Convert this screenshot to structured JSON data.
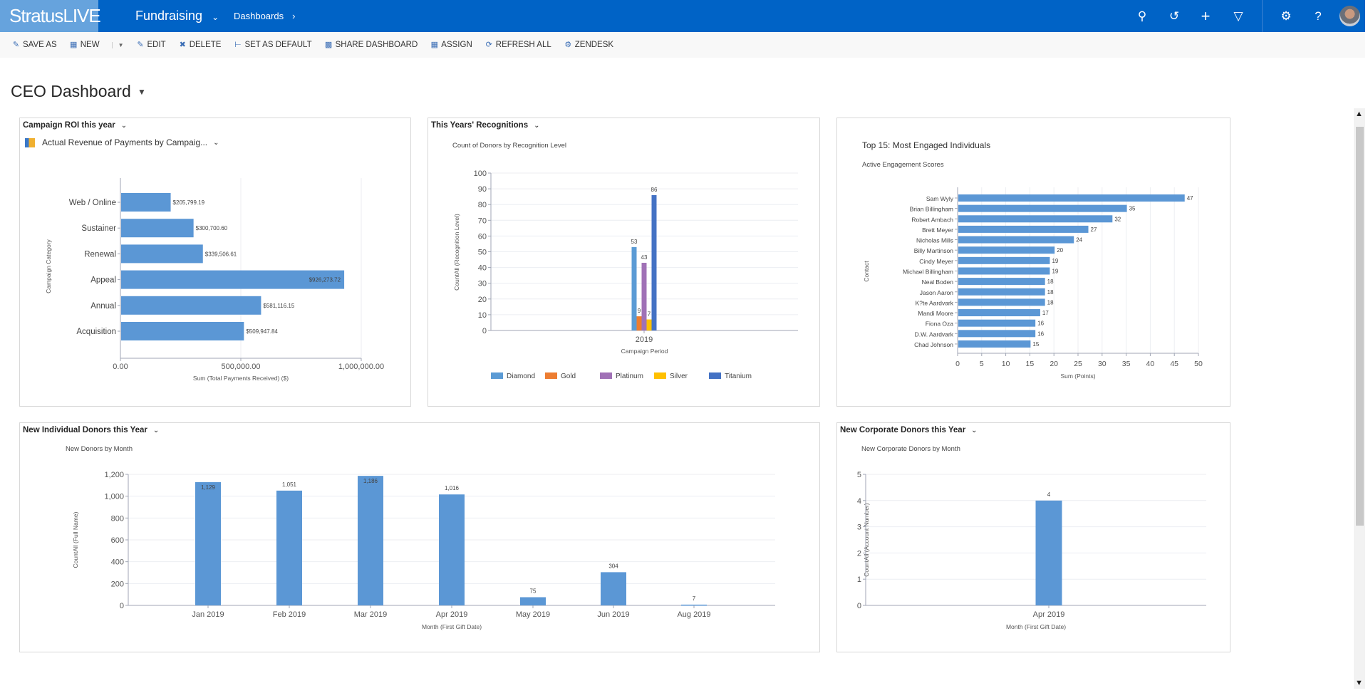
{
  "header": {
    "logo": "StratusLIVE",
    "app": "Fundraising",
    "area": "Dashboards",
    "icons": [
      "search-icon",
      "history-icon",
      "plus-icon",
      "filter-icon",
      "settings-icon",
      "help-icon"
    ]
  },
  "toolbar": {
    "items": [
      {
        "label": "SAVE AS",
        "icon": "save-icon"
      },
      {
        "label": "NEW",
        "icon": "new-icon"
      },
      {
        "label": "EDIT",
        "icon": "edit-icon"
      },
      {
        "label": "DELETE",
        "icon": "delete-icon"
      },
      {
        "label": "SET AS DEFAULT",
        "icon": "pin-icon"
      },
      {
        "label": "SHARE DASHBOARD",
        "icon": "share-icon"
      },
      {
        "label": "ASSIGN",
        "icon": "assign-icon"
      },
      {
        "label": "REFRESH ALL",
        "icon": "refresh-icon"
      },
      {
        "label": "ZENDESK",
        "icon": "gear-icon"
      }
    ]
  },
  "dashboard": {
    "title": "CEO Dashboard"
  },
  "panels": {
    "p1": {
      "title": "Campaign ROI this year",
      "view": "Actual Revenue of Payments by Campaig..."
    },
    "p2": {
      "title": "This Years' Recognitions"
    },
    "p4": {
      "title": "New Individual Donors this Year"
    },
    "p5": {
      "title": "New Corporate Donors this Year"
    }
  },
  "colors": {
    "bar": "#5b97d5",
    "header": "#0063c6"
  },
  "chart_data": [
    {
      "type": "bar",
      "orientation": "horizontal",
      "title": "",
      "xlabel": "Sum (Total Payments Received) ($)",
      "ylabel": "Campaign Category",
      "categories": [
        "Web / Online",
        "Sustainer",
        "Renewal",
        "Appeal",
        "Annual",
        "Acquisition"
      ],
      "values": [
        205799.19,
        300700.6,
        339506.61,
        926273.72,
        581116.15,
        509947.84
      ],
      "data_labels": [
        "$205,799.19",
        "$300,700.60",
        "$339,506.61",
        "$926,273.72",
        "$581,116.15",
        "$509,947.84"
      ],
      "xlim": [
        0,
        1000000
      ],
      "xticks": [
        "0.00",
        "500,000.00",
        "1,000,000.00"
      ],
      "grid": true
    },
    {
      "type": "bar",
      "orientation": "vertical",
      "title": "Count of Donors by Recognition Level",
      "xlabel": "Campaign Period",
      "ylabel": "CountAll (Recognition Level)",
      "categories": [
        "2019"
      ],
      "series": [
        {
          "name": "Diamond",
          "values": [
            53
          ],
          "color": "#5b9bd5"
        },
        {
          "name": "Gold",
          "values": [
            9
          ],
          "color": "#ed7d31"
        },
        {
          "name": "Platinum",
          "values": [
            43
          ],
          "color": "#a071b6"
        },
        {
          "name": "Silver",
          "values": [
            7
          ],
          "color": "#ffc000"
        },
        {
          "name": "Titanium",
          "values": [
            86
          ],
          "color": "#4472c4"
        }
      ],
      "ylim": [
        0,
        100
      ],
      "yticks": [
        "0",
        "10",
        "20",
        "30",
        "40",
        "50",
        "60",
        "70",
        "80",
        "90",
        "100"
      ],
      "legend": "bottom",
      "grid": true
    },
    {
      "type": "bar",
      "orientation": "horizontal",
      "title": "Top 15: Most Engaged Individuals",
      "subtitle": "Active Engagement Scores",
      "xlabel": "Sum (Points)",
      "ylabel": "Contact",
      "categories": [
        "Sam Wyly",
        "Brian Billingham",
        "Robert Ambach",
        "Brett Meyer",
        "Nicholas Mills",
        "Billy Martinson",
        "Cindy Meyer",
        "Michael Billingham",
        "Neal Boden",
        "Jason Aaron",
        "K?te Aardvark",
        "Mandi Moore",
        "Fiona Oza",
        "D.W. Aardvark",
        "Chad Johnson"
      ],
      "values": [
        47,
        35,
        32,
        27,
        24,
        20,
        19,
        19,
        18,
        18,
        18,
        17,
        16,
        16,
        15
      ],
      "xlim": [
        0,
        50
      ],
      "xticks": [
        "0",
        "5",
        "10",
        "15",
        "20",
        "25",
        "30",
        "35",
        "40",
        "45",
        "50"
      ],
      "grid": true
    },
    {
      "type": "bar",
      "orientation": "vertical",
      "title": "New Donors by Month",
      "xlabel": "Month (First Gift Date)",
      "ylabel": "CountAll (Full Name)",
      "categories": [
        "Jan 2019",
        "Feb 2019",
        "Mar 2019",
        "Apr 2019",
        "May 2019",
        "Jun 2019",
        "Aug 2019"
      ],
      "values": [
        1129,
        1051,
        1186,
        1016,
        75,
        304,
        7
      ],
      "data_labels": [
        "1,129",
        "1,051",
        "1,186",
        "1,016",
        "75",
        "304",
        "7"
      ],
      "ylim": [
        0,
        1200
      ],
      "yticks": [
        "0",
        "200",
        "400",
        "600",
        "800",
        "1,000",
        "1,200"
      ],
      "grid": true
    },
    {
      "type": "bar",
      "orientation": "vertical",
      "title": "New Corporate Donors by Month",
      "xlabel": "Month (First Gift Date)",
      "ylabel": "CountAll (Account Number)",
      "categories": [
        "Apr 2019"
      ],
      "values": [
        4
      ],
      "data_labels": [
        "4"
      ],
      "ylim": [
        0,
        5
      ],
      "yticks": [
        "0",
        "1",
        "2",
        "3",
        "4",
        "5"
      ],
      "grid": true
    }
  ]
}
